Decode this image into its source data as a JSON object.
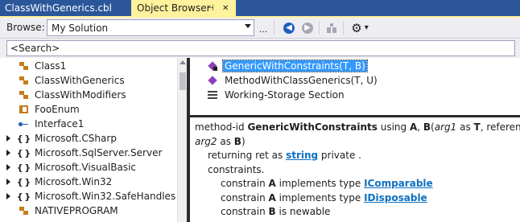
{
  "tabs": {
    "inactive_label": "ClassWithGenerics.cbl",
    "active_label": "Object Browser",
    "pin_glyph": "⊣",
    "close_glyph": "✕"
  },
  "toolbar": {
    "browse_label": "Browse:",
    "scope_value": "My Solution",
    "ellipsis_label": "...",
    "back_glyph": "◀",
    "forward_glyph": "▶",
    "settings_glyph": "⚙",
    "settings_dropdown_glyph": "▾"
  },
  "search": {
    "value": "<Search>"
  },
  "tree": {
    "items": [
      {
        "label": "Class1",
        "icon": "class-icon",
        "expandable": false
      },
      {
        "label": "ClassWithGenerics",
        "icon": "class-icon",
        "expandable": false,
        "selected": true
      },
      {
        "label": "ClassWithModifiers",
        "icon": "class-icon",
        "expandable": false
      },
      {
        "label": "FooEnum",
        "icon": "enum-icon",
        "expandable": false
      },
      {
        "label": "Interface1",
        "icon": "interface-icon",
        "expandable": false
      },
      {
        "label": "Microsoft.CSharp",
        "icon": "namespace-icon",
        "expandable": true
      },
      {
        "label": "Microsoft.SqlServer.Server",
        "icon": "namespace-icon",
        "expandable": true
      },
      {
        "label": "Microsoft.VisualBasic",
        "icon": "namespace-icon",
        "expandable": true
      },
      {
        "label": "Microsoft.Win32",
        "icon": "namespace-icon",
        "expandable": true
      },
      {
        "label": "Microsoft.Win32.SafeHandles",
        "icon": "namespace-icon",
        "expandable": true
      },
      {
        "label": "NATIVEPROGRAM",
        "icon": "class-icon",
        "expandable": false
      }
    ],
    "namespace_glyph": "{ }"
  },
  "members": {
    "items": [
      {
        "label": "GenericWithConstraints(T, B)",
        "icon": "method-locked-icon",
        "selected": true
      },
      {
        "label": "MethodWithClassGenerics(T, U)",
        "icon": "method-icon",
        "selected": false
      },
      {
        "label": "Working-Storage Section",
        "icon": "section-icon",
        "selected": false
      }
    ]
  },
  "description": {
    "l1_kw1": "method-id ",
    "l1_name": "GenericWithConstraints",
    "l1_kw2": " using ",
    "l1_a": "A",
    "l1_comma": ", ",
    "l1_b": "B",
    "l1_paren": "(",
    "l1_arg1": "arg1",
    "l1_as": " as ",
    "l1_t": "T",
    "l1_ref": ", reference",
    "l2_arg2": "arg2",
    "l2_as": " as ",
    "l2_b": "B",
    "l2_close": ")",
    "l3_pre": "returning ret as ",
    "l3_link": "string",
    "l3_post": " private .",
    "l4": "constraints.",
    "l5_pre": "constrain ",
    "l5_a": "A",
    "l5_mid": " implements type ",
    "l5_link": "IComparable",
    "l6_pre": "constrain ",
    "l6_a": "A",
    "l6_mid": " implements type ",
    "l6_link": "IDisposable",
    "l7_pre": "constrain ",
    "l7_b": "B",
    "l7_post": " is newable"
  }
}
